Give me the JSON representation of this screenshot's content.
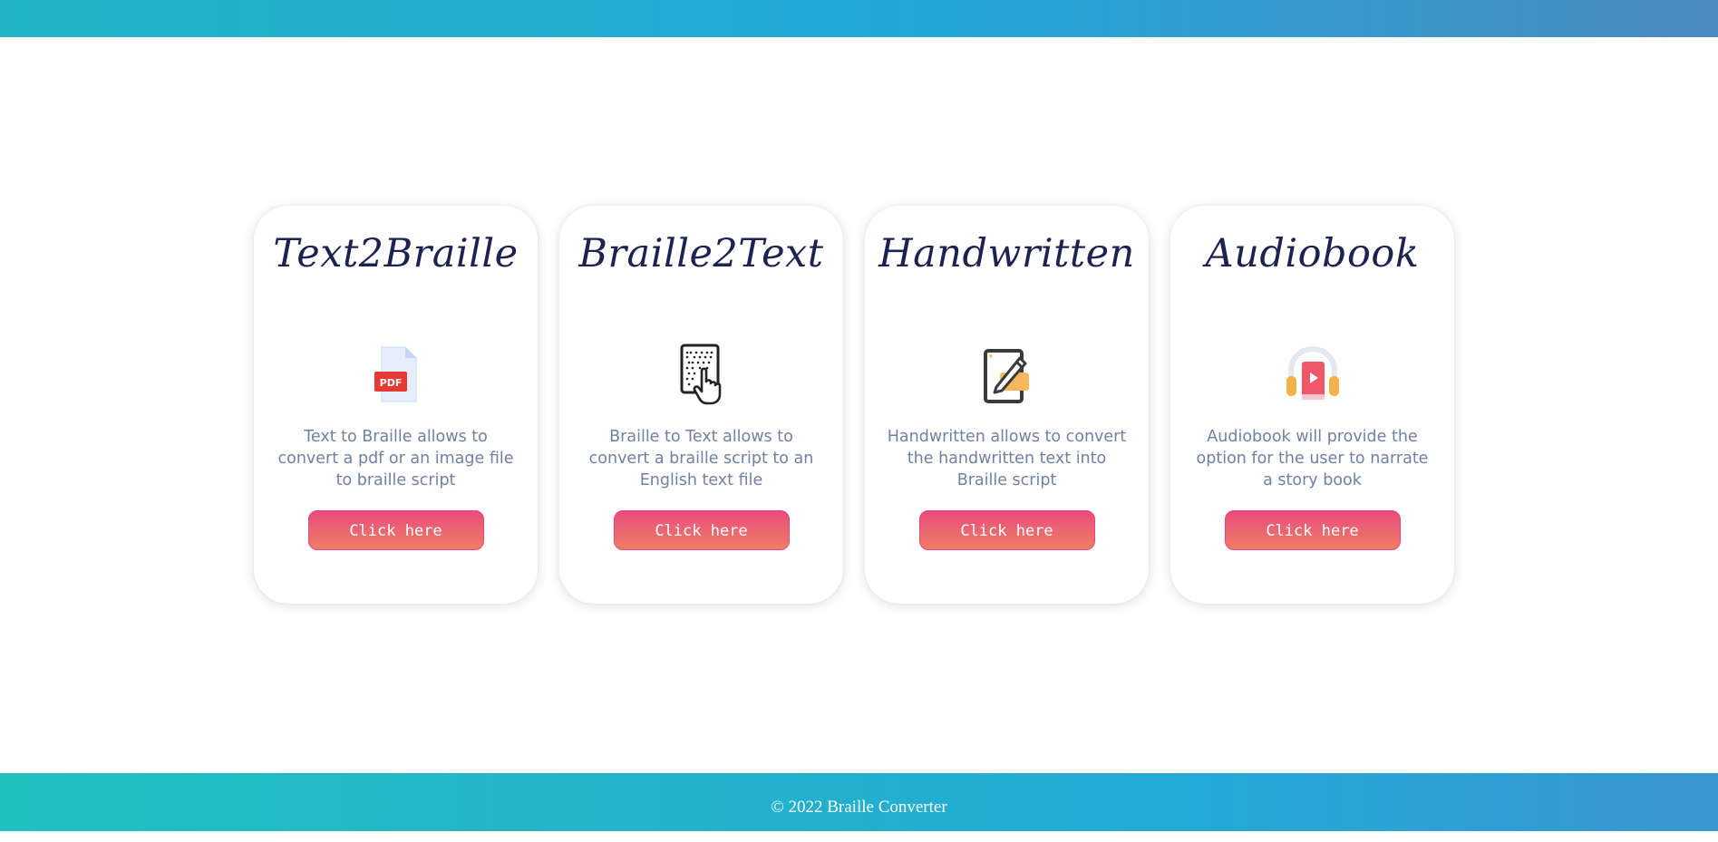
{
  "cards": [
    {
      "title": "Text2Braille",
      "icon": "pdf-file-icon",
      "description": "Text to Braille allows to convert a pdf or an image file to braille script",
      "button_label": "Click here"
    },
    {
      "title": "Braille2Text",
      "icon": "braille-touch-icon",
      "description": "Braille to Text allows to convert a braille script to an English text file",
      "button_label": "Click here"
    },
    {
      "title": "Handwritten",
      "icon": "handwriting-pen-icon",
      "description": "Handwritten allows to convert the handwritten text into Braille script",
      "button_label": "Click here"
    },
    {
      "title": "Audiobook",
      "icon": "audiobook-headphones-icon",
      "description": "Audiobook will provide the option for the user to narrate a story book",
      "button_label": "Click here"
    }
  ],
  "footer": {
    "text": "© 2022 Braille Converter"
  },
  "colors": {
    "title": "#1d2350",
    "description": "#6f82a2",
    "button_gradient_top": "#ea4a7d",
    "button_gradient_bottom": "#ef7f63",
    "header_gradient_start": "#1fb5c7",
    "footer_gradient_start": "#21c0c0"
  }
}
